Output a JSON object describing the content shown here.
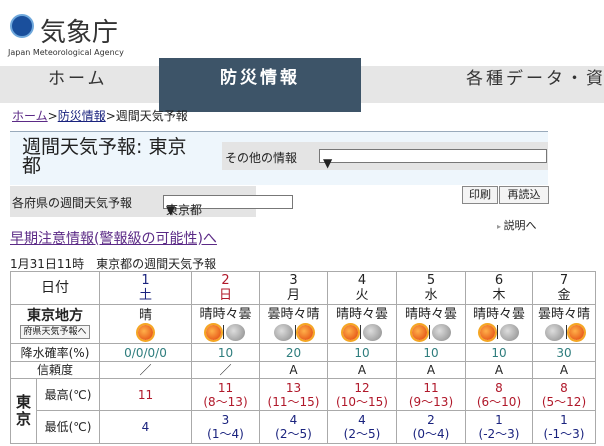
{
  "logo": {
    "jp": "気象庁",
    "en": "Japan Meteorological Agency"
  },
  "nav": {
    "home": "ホーム",
    "disaster": "防災情報",
    "data": "各種データ・資"
  },
  "breadcrumb": {
    "home": "ホーム",
    "disaster": "防災情報",
    "current": "週間天気予報",
    "sep": ">"
  },
  "title": "週間天気予報: 東京都",
  "other_info": {
    "label": "その他の情報",
    "value": ""
  },
  "pref": {
    "label": "各府県の週間天気予報",
    "value": "東京都"
  },
  "buttons": {
    "print": "印刷",
    "reload": "再読込"
  },
  "explain": "説明へ",
  "early_warning": "早期注意情報(警報級の可能性)へ",
  "timestamp": "1月31日11時　東京都の週間天気予報",
  "table": {
    "date_label": "日付",
    "region": "東京地方",
    "pref_button": "府県天気予報へ",
    "pop_label": "降水確率(%)",
    "rel_label": "信頼度",
    "city": "東京",
    "max_label": "最高(℃)",
    "min_label": "最低(℃)",
    "days": [
      {
        "date": "1",
        "dow": "土",
        "cls": "sat",
        "weather": "晴",
        "icons": [
          "sun"
        ],
        "pop": "0/0/0/0",
        "rel": "／",
        "max": "11",
        "max_range": "",
        "min": "4",
        "min_range": ""
      },
      {
        "date": "2",
        "dow": "日",
        "cls": "sun",
        "weather": "晴時々曇",
        "icons": [
          "sun",
          "cloud"
        ],
        "pop": "10",
        "rel": "／",
        "max": "11",
        "max_range": "(8〜13)",
        "min": "3",
        "min_range": "(1〜4)"
      },
      {
        "date": "3",
        "dow": "月",
        "cls": "",
        "weather": "曇時々晴",
        "icons": [
          "cloud",
          "sun"
        ],
        "pop": "20",
        "rel": "A",
        "max": "13",
        "max_range": "(11〜15)",
        "min": "4",
        "min_range": "(2〜5)"
      },
      {
        "date": "4",
        "dow": "火",
        "cls": "",
        "weather": "晴時々曇",
        "icons": [
          "sun",
          "cloud"
        ],
        "pop": "10",
        "rel": "A",
        "max": "12",
        "max_range": "(10〜15)",
        "min": "4",
        "min_range": "(2〜5)"
      },
      {
        "date": "5",
        "dow": "水",
        "cls": "",
        "weather": "晴時々曇",
        "icons": [
          "sun",
          "cloud"
        ],
        "pop": "10",
        "rel": "A",
        "max": "11",
        "max_range": "(9〜13)",
        "min": "2",
        "min_range": "(0〜4)"
      },
      {
        "date": "6",
        "dow": "木",
        "cls": "",
        "weather": "晴時々曇",
        "icons": [
          "sun",
          "cloud"
        ],
        "pop": "10",
        "rel": "A",
        "max": "8",
        "max_range": "(6〜10)",
        "min": "1",
        "min_range": "(-2〜3)"
      },
      {
        "date": "7",
        "dow": "金",
        "cls": "",
        "weather": "曇時々晴",
        "icons": [
          "cloud",
          "sun"
        ],
        "pop": "30",
        "rel": "A",
        "max": "8",
        "max_range": "(5〜12)",
        "min": "1",
        "min_range": "(-1〜3)"
      }
    ]
  }
}
